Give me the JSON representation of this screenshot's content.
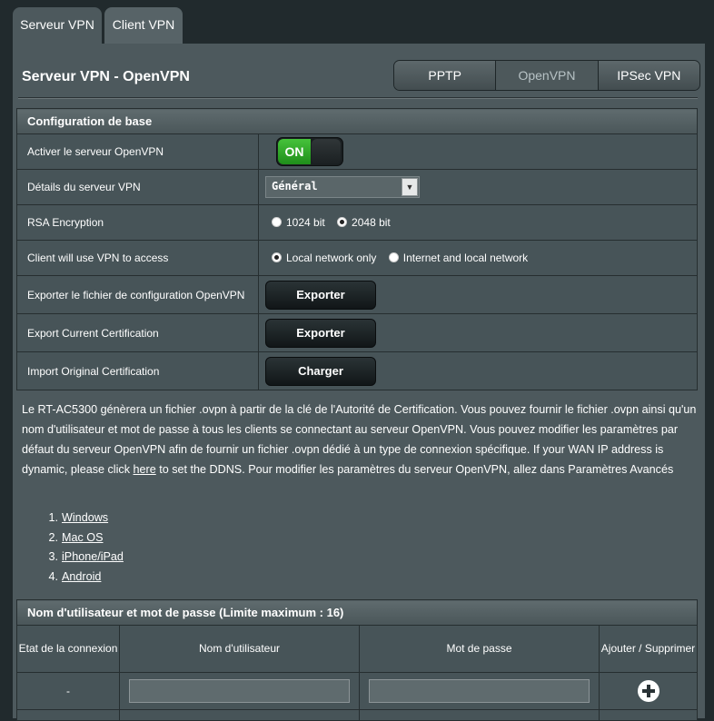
{
  "tabs": [
    {
      "label": "Serveur VPN",
      "active": true
    },
    {
      "label": "Client VPN",
      "active": false
    }
  ],
  "page_title": "Serveur VPN - OpenVPN",
  "protocol_tabs": [
    {
      "label": "PPTP",
      "active": false
    },
    {
      "label": "OpenVPN",
      "active": true
    },
    {
      "label": "IPSec VPN",
      "active": false
    }
  ],
  "basic_config": {
    "header": "Configuration de base",
    "rows": {
      "enable": {
        "label": "Activer le serveur OpenVPN",
        "toggle_text": "ON",
        "enabled": true
      },
      "details": {
        "label": "Détails du serveur VPN",
        "selected": "Général"
      },
      "rsa": {
        "label": "RSA Encryption",
        "options": [
          "1024 bit",
          "2048 bit"
        ],
        "selected": "2048 bit"
      },
      "access": {
        "label": "Client will use VPN to access",
        "options": [
          "Local network only",
          "Internet and local network"
        ],
        "selected": "Local network only"
      },
      "export_config": {
        "label": "Exporter le fichier de configuration OpenVPN",
        "button": "Exporter"
      },
      "export_cert": {
        "label": "Export Current Certification",
        "button": "Exporter"
      },
      "import_cert": {
        "label": "Import Original Certification",
        "button": "Charger"
      }
    }
  },
  "description": {
    "before_link": "Le RT-AC5300 génèrera un fichier .ovpn à partir de la clé de l'Autorité de Certification. Vous pouvez fournir le fichier .ovpn ainsi qu'un nom d'utilisateur et mot de passe à tous les clients se connectant au serveur OpenVPN. Vous pouvez modifier les paramètres par défaut du serveur OpenVPN afin de fournir un fichier .ovpn dédié à un type de connexion spécifique. If your WAN IP address is dynamic, please click ",
    "link": "here",
    "after_link": " to set the DDNS. Pour modifier les paramètres du serveur OpenVPN, allez dans Paramètres Avancés"
  },
  "os_links": [
    {
      "num": "1.",
      "label": "Windows"
    },
    {
      "num": "2.",
      "label": "Mac OS"
    },
    {
      "num": "3.",
      "label": "iPhone/iPad"
    },
    {
      "num": "4.",
      "label": "Android"
    }
  ],
  "users_table": {
    "header": "Nom d'utilisateur et mot de passe (Limite maximum : 16)",
    "columns": [
      "Etat de la connexion",
      "Nom d'utilisateur",
      "Mot de passe",
      "Ajouter / Supprimer"
    ],
    "new_row_status": "-"
  }
}
